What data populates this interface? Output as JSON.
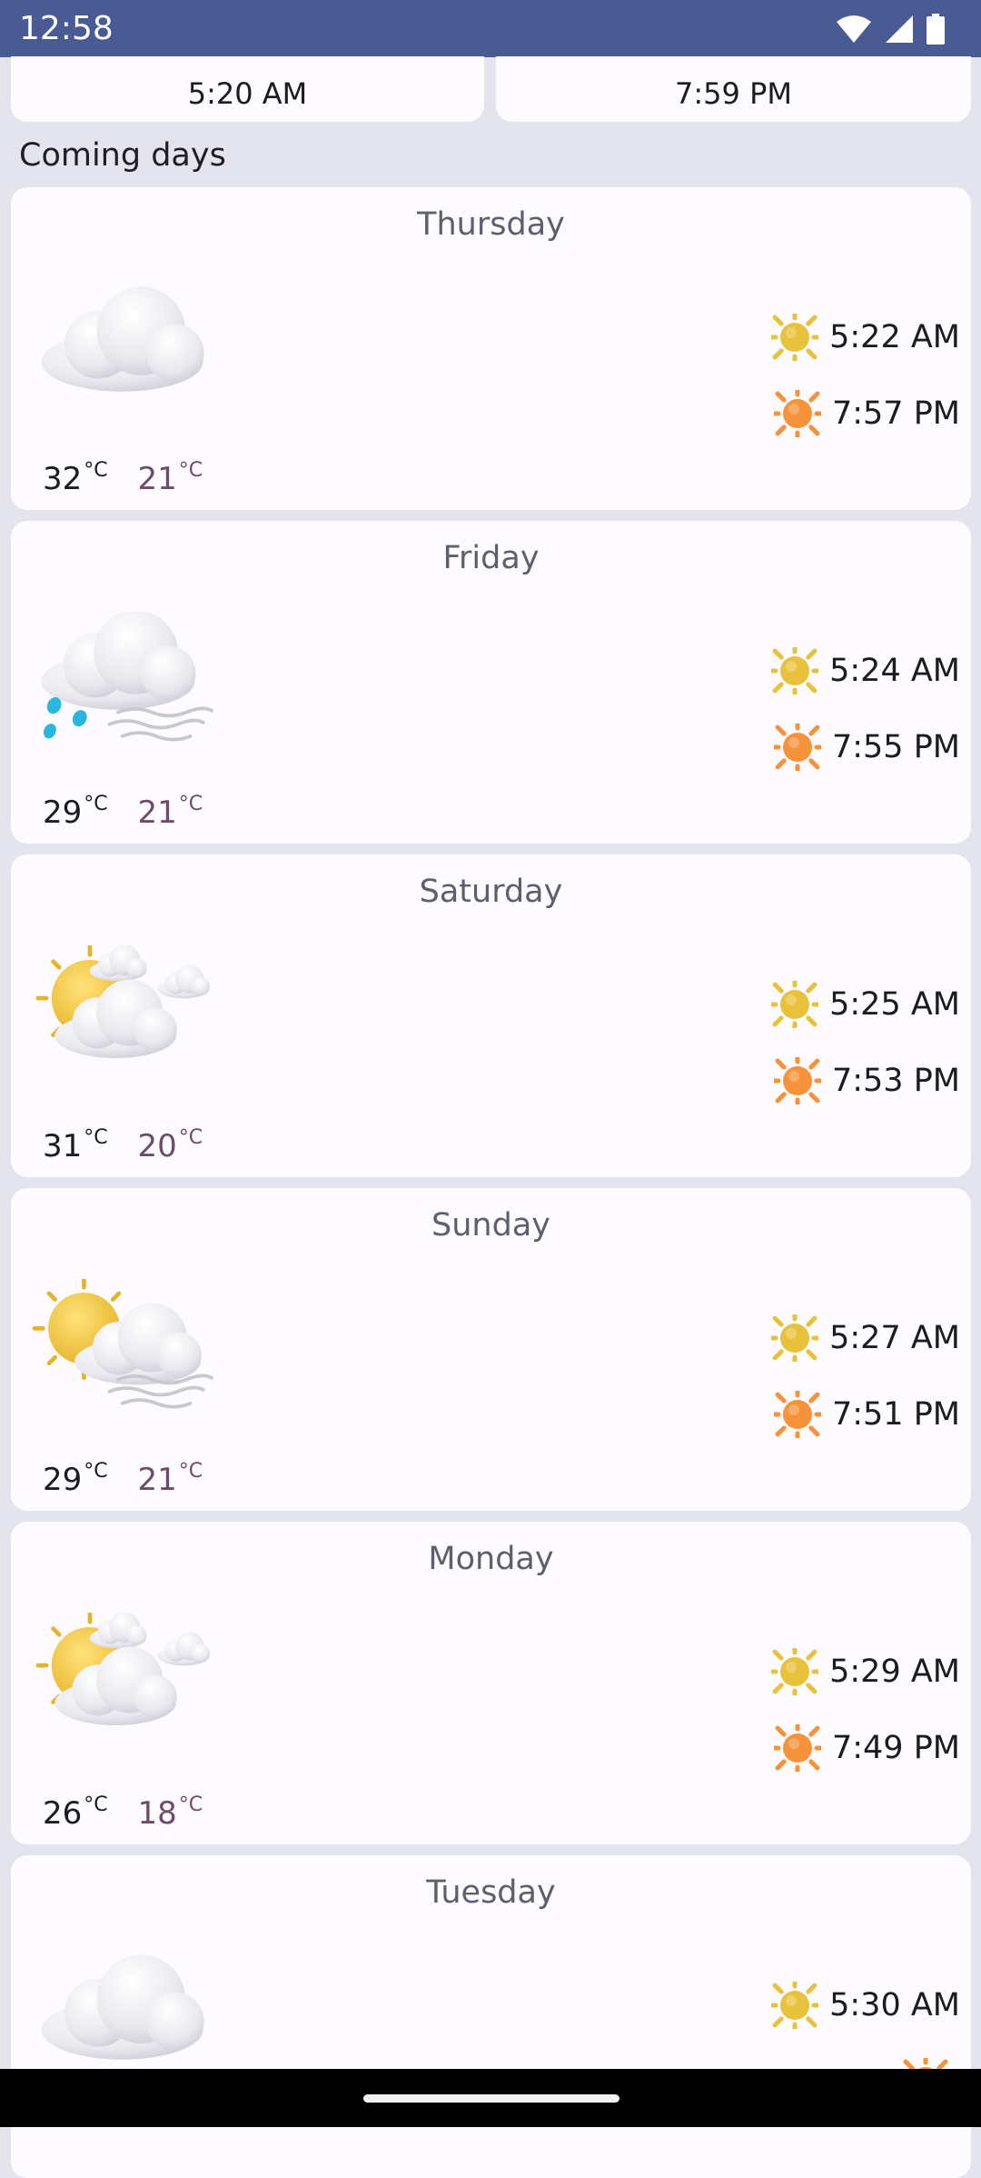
{
  "status_bar": {
    "time": "12:58",
    "icons": [
      "wifi-icon",
      "signal-icon",
      "battery-icon"
    ]
  },
  "today": {
    "sunrise": "5:20 AM",
    "sunset": "7:59 PM"
  },
  "section_title": "Coming days",
  "temperature_unit": "°C",
  "colors": {
    "status_bar": "#4A5A92",
    "background": "#E4E4EE",
    "card": "#FDFBFF",
    "min_temp": "#6E4B6A",
    "sunrise_sun": "#E8C23A",
    "sunset_sun": "#F6923A"
  },
  "days": [
    {
      "name": "Thursday",
      "icon": "cloudy-icon",
      "max": "32",
      "min": "21",
      "sunrise": "5:22 AM",
      "sunset": "7:57 PM"
    },
    {
      "name": "Friday",
      "icon": "rain-wind-cloud-icon",
      "max": "29",
      "min": "21",
      "sunrise": "5:24 AM",
      "sunset": "7:55 PM"
    },
    {
      "name": "Saturday",
      "icon": "partly-cloudy-icon",
      "max": "31",
      "min": "20",
      "sunrise": "5:25 AM",
      "sunset": "7:53 PM"
    },
    {
      "name": "Sunday",
      "icon": "sun-cloud-wind-icon",
      "max": "29",
      "min": "21",
      "sunrise": "5:27 AM",
      "sunset": "7:51 PM"
    },
    {
      "name": "Monday",
      "icon": "partly-cloudy-icon",
      "max": "26",
      "min": "18",
      "sunrise": "5:29 AM",
      "sunset": "7:49 PM"
    },
    {
      "name": "Tuesday",
      "icon": "cloudy-icon",
      "max": "",
      "min": "",
      "sunrise": "5:30 AM",
      "sunset": ""
    }
  ]
}
